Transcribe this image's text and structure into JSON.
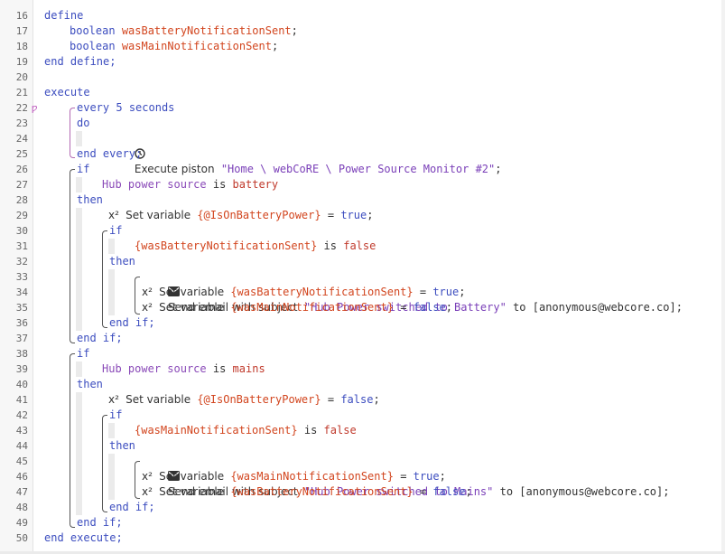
{
  "line_numbers": [
    "16",
    "17",
    "18",
    "19",
    "20",
    "21",
    "22",
    "23",
    "24",
    "25",
    "26",
    "27",
    "28",
    "29",
    "30",
    "31",
    "32",
    "33",
    "34",
    "35",
    "36",
    "37",
    "38",
    "39",
    "40",
    "41",
    "42",
    "43",
    "44",
    "45",
    "46",
    "47",
    "48",
    "49",
    "50"
  ],
  "marker_22": "ƿ",
  "define": {
    "open": "define",
    "var1_type": "boolean",
    "var1_name": "wasBatteryNotificationSent",
    "var2_type": "boolean",
    "var2_name": "wasMainNotificationSent",
    "semicolon": ";",
    "close": "end define;"
  },
  "execute": {
    "open": "execute",
    "close": "end execute;"
  },
  "every": {
    "keyword": "every",
    "amount": "5",
    "unit": "seconds",
    "do": "do",
    "icon": "clock-icon",
    "action_text": "Execute piston",
    "piston_name": "\"Home \\ webCoRE \\ Power Source Monitor #2\"",
    "semicolon": ";",
    "end": "end every;"
  },
  "block1": {
    "if": "if",
    "device": "Hub",
    "attribute": "power source",
    "operator": "is",
    "value": "battery",
    "then": "then",
    "set_icon": "x²",
    "set_text": "Set variable",
    "set_var": "{@IsOnBatteryPower}",
    "eq": "=",
    "set_value": "true",
    "semicolon": ";",
    "inner_if": "if",
    "inner_cond_var": "{wasBatteryNotificationSent}",
    "inner_cond_op": "is",
    "inner_cond_value": "false",
    "inner_then": "then",
    "email_icon": "envelope-icon",
    "email_text": "Send email with subject",
    "email_subject": "\"Hub Power switched to Battery\"",
    "email_to": "to",
    "email_addr": "[anonymous@webcore.co]",
    "set2_var": "{wasBatteryNotificationSent}",
    "set2_value": "true",
    "set3_var": "{wasMainNotificationSent}",
    "set3_value": "false",
    "inner_end": "end if;",
    "end": "end if;"
  },
  "block2": {
    "if": "if",
    "device": "Hub",
    "attribute": "power source",
    "operator": "is",
    "value": "mains",
    "then": "then",
    "set_icon": "x²",
    "set_text": "Set variable",
    "set_var": "{@IsOnBatteryPower}",
    "eq": "=",
    "set_value": "false",
    "semicolon": ";",
    "inner_if": "if",
    "inner_cond_var": "{wasMainNotificationSent}",
    "inner_cond_op": "is",
    "inner_cond_value": "false",
    "inner_then": "then",
    "email_icon": "envelope-icon",
    "email_text": "Send email with subject",
    "email_subject": "\"Hub Power switched to Mains\"",
    "email_to": "to",
    "email_addr": "[anonymous@webcore.co]",
    "set2_var": "{wasMainNotificationSent}",
    "set2_value": "true",
    "set3_var": "{wasBatteryNotificationSent}",
    "set3_value": "false",
    "inner_end": "end if;",
    "end": "end if;"
  }
}
